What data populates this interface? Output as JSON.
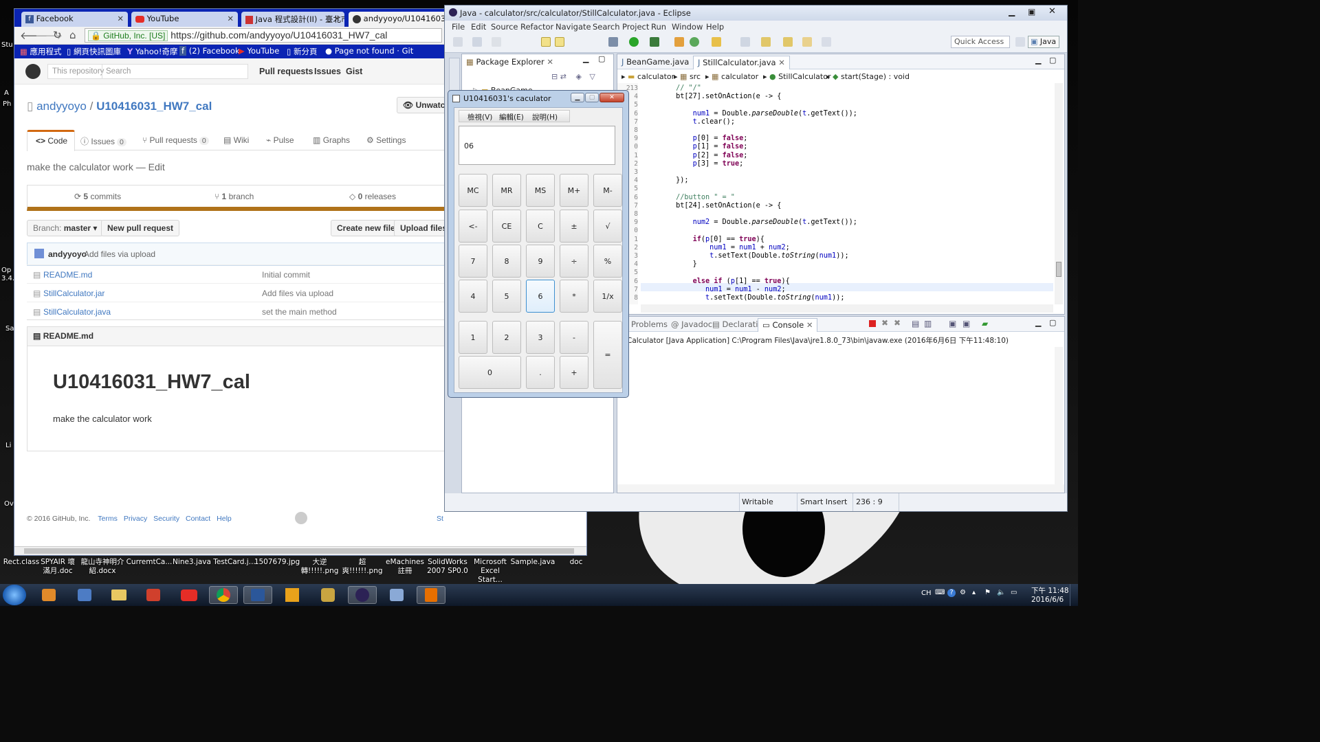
{
  "desktop": {
    "side_labels": [
      "Stu",
      "A",
      "Ph",
      "Op",
      "3.4.",
      "Sa",
      "Li",
      "Ov"
    ],
    "files": [
      {
        "label": "Rect.class"
      },
      {
        "label": "SPYAIR 壞滿月.doc"
      },
      {
        "label": "龍山寺神明介紹.docx"
      },
      {
        "label": "CurremtCa..."
      },
      {
        "label": "Nine3.java"
      },
      {
        "label": "TestCard.j..."
      },
      {
        "label": "1507679.jpg"
      },
      {
        "label": "大逆轉!!!!!.png"
      },
      {
        "label": "超爽!!!!!!.png"
      },
      {
        "label": "eMachines 註冊"
      },
      {
        "label": "SolidWorks 2007 SP0.0"
      },
      {
        "label": "Microsoft Excel Start..."
      },
      {
        "label": "Sample.java"
      },
      {
        "label": "doc"
      }
    ]
  },
  "browser": {
    "tabs": [
      {
        "label": "Facebook",
        "icon": "facebook-icon"
      },
      {
        "label": "YouTube",
        "icon": "youtube-icon"
      },
      {
        "label": "Java 程式設計(II) - 臺北市",
        "icon": "pdf-icon"
      },
      {
        "label": "andyyoyo/U10416031_",
        "icon": "github-icon"
      }
    ],
    "secure_label": "GitHub, Inc. [US]",
    "url": "https://github.com/andyyoyo/U10416031_HW7_cal",
    "bookmarks": [
      {
        "label": "應用程式"
      },
      {
        "label": "網頁快訊圖庫"
      },
      {
        "label": "Yahoo!奇摩"
      },
      {
        "label": "(2) Facebook"
      },
      {
        "label": "YouTube"
      },
      {
        "label": "新分頁"
      },
      {
        "label": "Page not found · Git"
      }
    ]
  },
  "github": {
    "search_scope": "This repository",
    "search_placeholder": "Search",
    "nav": [
      "Pull requests",
      "Issues",
      "Gist"
    ],
    "owner": "andyyoyo",
    "slash": "/",
    "repo": "U10416031_HW7_cal",
    "unwatch": "Unwatch",
    "repo_tabs": [
      {
        "label": "Code",
        "count": ""
      },
      {
        "label": "Issues",
        "count": "0"
      },
      {
        "label": "Pull requests",
        "count": "0"
      },
      {
        "label": "Wiki",
        "count": ""
      },
      {
        "label": "Pulse",
        "count": ""
      },
      {
        "label": "Graphs",
        "count": ""
      },
      {
        "label": "Settings",
        "count": ""
      }
    ],
    "description": "make the calculator work — Edit",
    "stats": {
      "commits": "5",
      "commits_label": "commits",
      "branch": "1",
      "branch_label": "branch",
      "releases": "0",
      "releases_label": "releases"
    },
    "branch_prefix": "Branch:",
    "branch_name": "master",
    "new_pr": "New pull request",
    "create_file": "Create new file",
    "upload_files": "Upload files",
    "latest_author": "andyyoyo",
    "latest_message": "Add files via upload",
    "files": [
      {
        "name": "README.md",
        "message": "Initial commit"
      },
      {
        "name": "StillCalculator.jar",
        "message": "Add files via upload"
      },
      {
        "name": "StillCalculator.java",
        "message": "set the main method"
      }
    ],
    "readme_header": "README.md",
    "readme_title": "U10416031_HW7_cal",
    "readme_body": "make the calculator work",
    "footer": {
      "copyright": "© 2016 GitHub, Inc.",
      "links": [
        "Terms",
        "Privacy",
        "Security",
        "Contact",
        "Help"
      ],
      "truncated": "St"
    }
  },
  "eclipse": {
    "title": "Java - calculator/src/calculator/StillCalculator.java - Eclipse",
    "menu": [
      "File",
      "Edit",
      "Source",
      "Refactor",
      "Navigate",
      "Search",
      "Project",
      "Run",
      "Window",
      "Help"
    ],
    "quick_access": "Quick Access",
    "perspective": "Java",
    "package_explorer": "Package Explorer",
    "tree_item": "BeanGame",
    "editor_tabs": [
      "BeanGame.java",
      "StillCalculator.java"
    ],
    "breadcrumb": [
      "calculator",
      "src",
      "calculator",
      "StillCalculator",
      "start(Stage) : void"
    ],
    "line_numbers": [
      "213",
      "4",
      "5",
      "6",
      "7",
      "8",
      "9",
      "0",
      "1",
      "2",
      "3",
      "4",
      "5",
      "6",
      "7",
      "8",
      "9",
      "0",
      "1",
      "2",
      "3",
      "4",
      "5",
      "6",
      "7",
      "8"
    ],
    "console_tabs": [
      "Problems",
      "Javadoc",
      "Declaration",
      "Console"
    ],
    "console_text": "Calculator [Java Application] C:\\Program Files\\Java\\jre1.8.0_73\\bin\\javaw.exe (2016年6月6日 下午11:48:10)",
    "status": {
      "writable": "Writable",
      "insert": "Smart Insert",
      "position": "236 : 9"
    }
  },
  "calculator": {
    "title": "U10416031's caculator",
    "menu": [
      "檢視(V)",
      "編輯(E)",
      "說明(H)"
    ],
    "display": "06",
    "keys": {
      "mc": "MC",
      "mr": "MR",
      "ms": "MS",
      "mplus": "M+",
      "mminus": "M-",
      "back": "<-",
      "ce": "CE",
      "c": "C",
      "sign": "±",
      "sqrt": "√",
      "k7": "7",
      "k8": "8",
      "k9": "9",
      "div": "÷",
      "pct": "%",
      "k4": "4",
      "k5": "5",
      "k6": "6",
      "mul": "*",
      "inv": "1/x",
      "k1": "1",
      "k2": "2",
      "k3": "3",
      "sub": "-",
      "eq": "=",
      "k0": "0",
      "dot": ".",
      "add": "+"
    }
  },
  "taskbar": {
    "lang": "CH",
    "time": "下午 11:48",
    "date": "2016/6/6"
  },
  "colors": {
    "chrome_frame": "#0b24b3",
    "github_accent": "#4078c0",
    "focus_key": "#3c8fd0"
  }
}
